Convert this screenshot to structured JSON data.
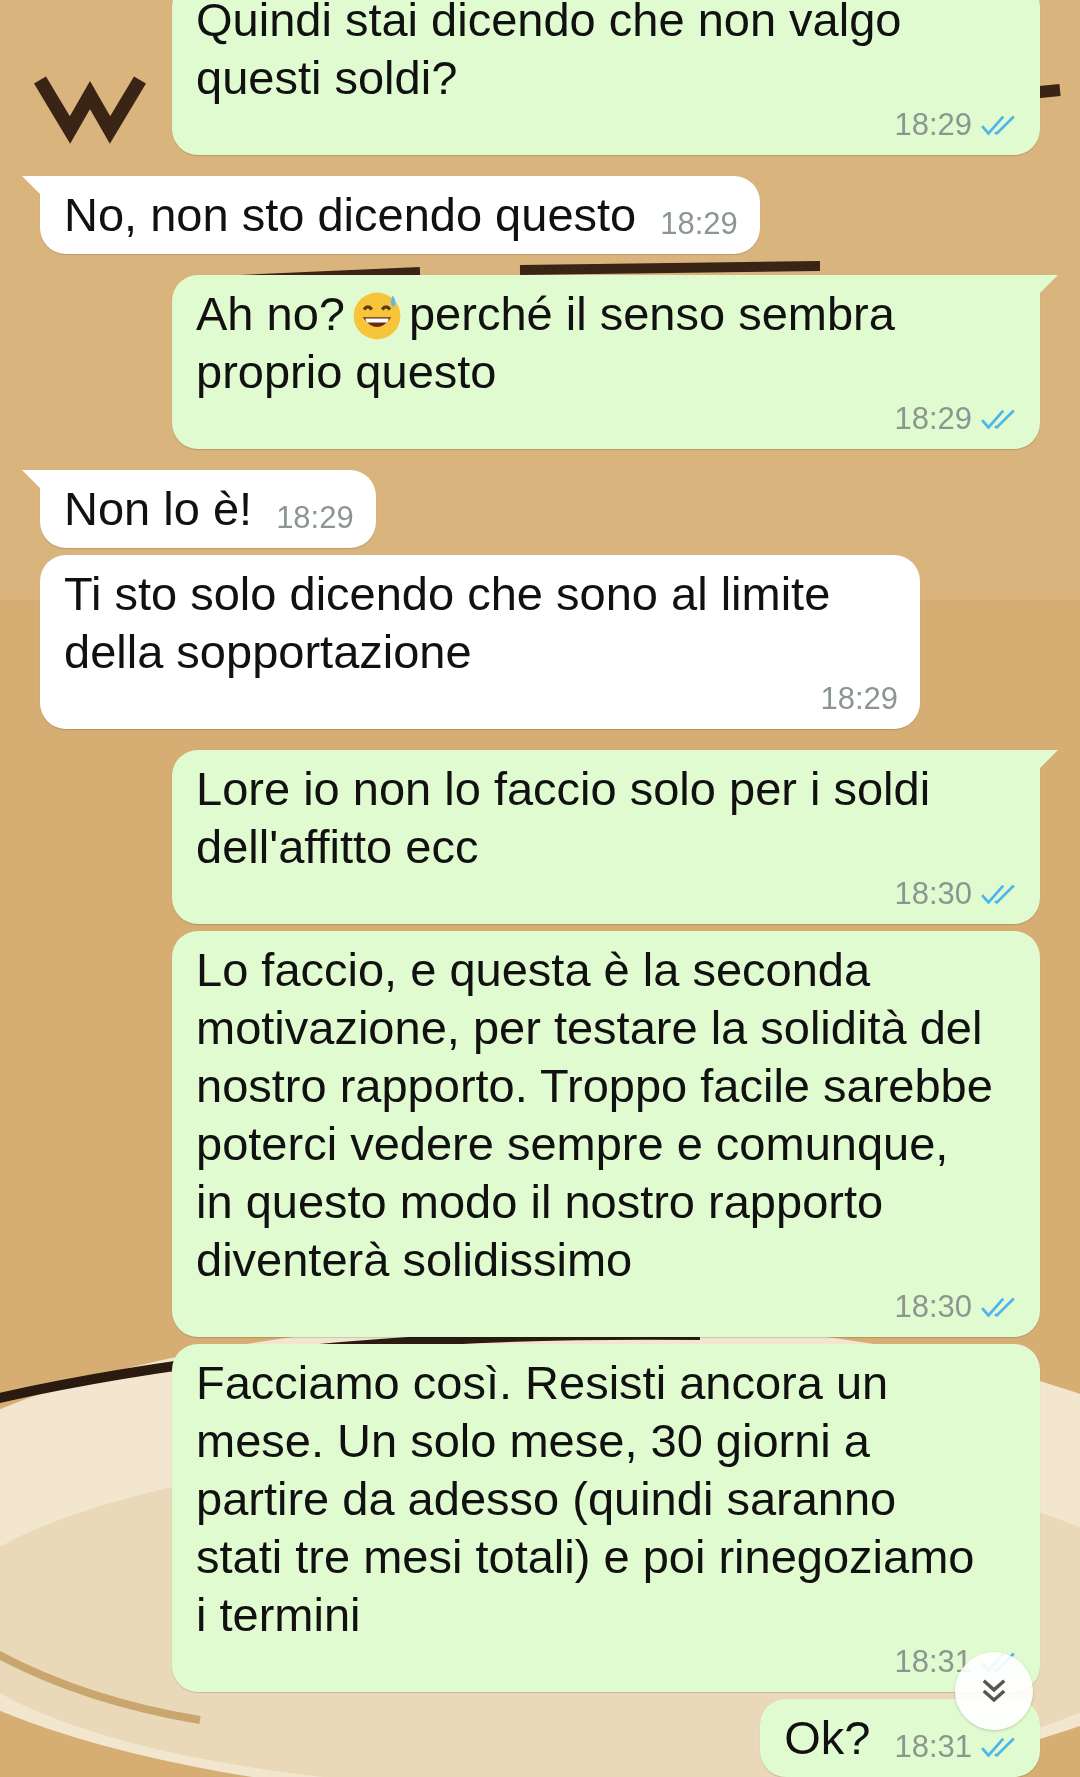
{
  "messages": [
    {
      "kind": "outgoing",
      "tail": false,
      "segments": [
        {
          "kind": "text",
          "text": "Quindi stai dicendo che non valgo questi soldi?"
        }
      ],
      "time": "18:29",
      "read": true
    },
    {
      "kind": "incoming",
      "tail": true,
      "segments": [
        {
          "kind": "text",
          "text": "No, non sto dicendo questo"
        }
      ],
      "time": "18:29"
    },
    {
      "kind": "outgoing",
      "tail": true,
      "segments": [
        {
          "kind": "text",
          "text": "Ah no?"
        },
        {
          "kind": "emoji"
        },
        {
          "kind": "text",
          "text": "perché il senso sembra proprio questo"
        }
      ],
      "time": "18:29",
      "read": true
    },
    {
      "kind": "incoming",
      "tail": true,
      "segments": [
        {
          "kind": "text",
          "text": "Non lo è!"
        }
      ],
      "time": "18:29"
    },
    {
      "kind": "incoming",
      "tail": false,
      "segments": [
        {
          "kind": "text",
          "text": "Ti sto solo dicendo che sono al limite della sopportazione"
        }
      ],
      "time": "18:29"
    },
    {
      "kind": "outgoing",
      "tail": true,
      "segments": [
        {
          "kind": "text",
          "text": "Lore io non lo faccio solo per i soldi dell'affitto ecc"
        }
      ],
      "time": "18:30",
      "read": true
    },
    {
      "kind": "outgoing",
      "tail": false,
      "segments": [
        {
          "kind": "text",
          "text": "Lo faccio, e questa è la seconda motivazione, per testare la solidità del nostro rapporto. Troppo facile sarebbe poterci vedere sempre e comunque, in questo modo il nostro rapporto diventerà solidissimo"
        }
      ],
      "time": "18:30",
      "read": true
    },
    {
      "kind": "outgoing",
      "tail": false,
      "segments": [
        {
          "kind": "text",
          "text": "Facciamo così. Resisti ancora un mese. Un solo mese, 30 giorni a partire da adesso (quindi saranno stati tre mesi totali) e poi rinegoziamo i termini"
        }
      ],
      "time": "18:31",
      "read": true
    },
    {
      "kind": "outgoing",
      "tail": false,
      "segments": [
        {
          "kind": "text",
          "text": "Ok?"
        }
      ],
      "time": "18:31",
      "read": true
    }
  ]
}
